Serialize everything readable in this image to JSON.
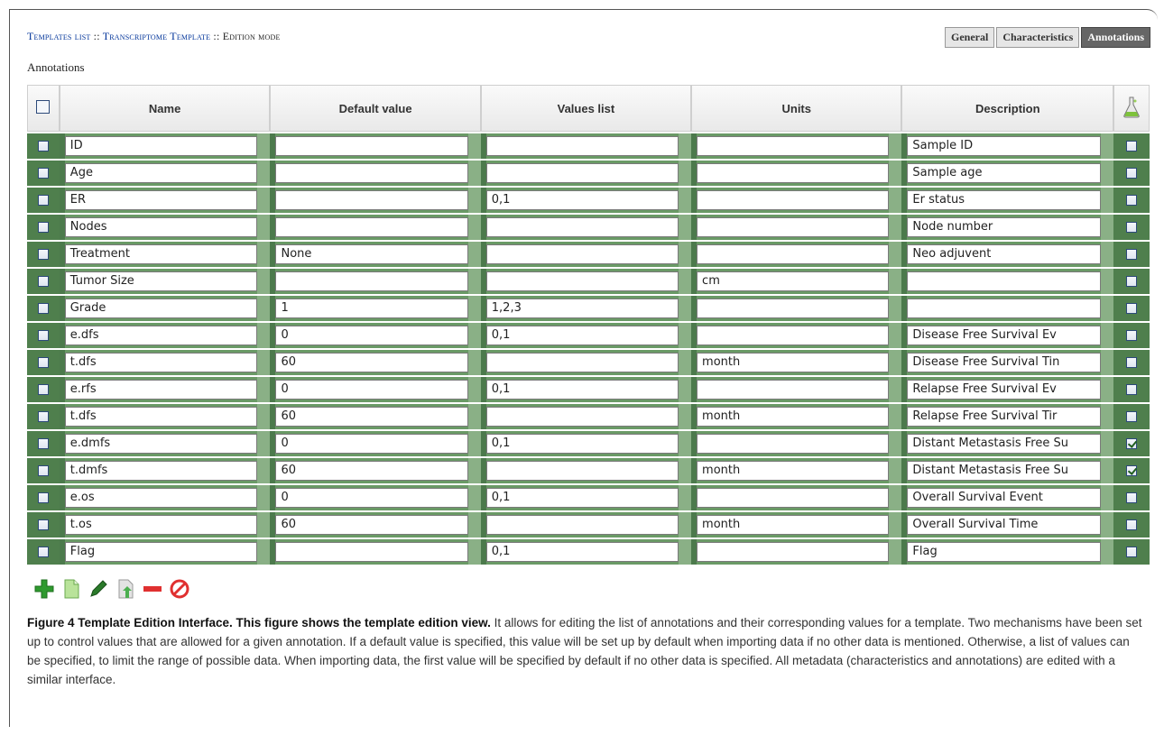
{
  "breadcrumb": {
    "templates_list": "Templates list",
    "sep1": " :: ",
    "template": "Transcriptome Template",
    "sep2": " :: ",
    "mode": "Edition mode"
  },
  "tabs": [
    {
      "label": "General",
      "active": false
    },
    {
      "label": "Characteristics",
      "active": false
    },
    {
      "label": "Annotations",
      "active": true
    }
  ],
  "section_title": "Annotations",
  "columns": {
    "name": "Name",
    "default_value": "Default value",
    "values_list": "Values list",
    "units": "Units",
    "description": "Description"
  },
  "header_icon": "flask-icon",
  "rows": [
    {
      "name": "ID",
      "default": "",
      "values": "",
      "units": "",
      "description": "Sample ID",
      "flag": false
    },
    {
      "name": "Age",
      "default": "",
      "values": "",
      "units": "",
      "description": "Sample age",
      "flag": false
    },
    {
      "name": "ER",
      "default": "",
      "values": "0,1",
      "units": "",
      "description": "Er status",
      "flag": false
    },
    {
      "name": "Nodes",
      "default": "",
      "values": "",
      "units": "",
      "description": "Node number",
      "flag": false
    },
    {
      "name": "Treatment",
      "default": "None",
      "values": "",
      "units": "",
      "description": "Neo adjuvent",
      "flag": false
    },
    {
      "name": "Tumor Size",
      "default": "",
      "values": "",
      "units": "cm",
      "description": "",
      "flag": false
    },
    {
      "name": "Grade",
      "default": "1",
      "values": "1,2,3",
      "units": "",
      "description": "",
      "flag": false
    },
    {
      "name": "e.dfs",
      "default": "0",
      "values": "0,1",
      "units": "",
      "description": "Disease Free Survival Ev",
      "flag": false
    },
    {
      "name": "t.dfs",
      "default": "60",
      "values": "",
      "units": "month",
      "description": "Disease Free Survival Tin",
      "flag": false
    },
    {
      "name": "e.rfs",
      "default": "0",
      "values": "0,1",
      "units": "",
      "description": "Relapse Free Survival Ev",
      "flag": false
    },
    {
      "name": "t.dfs",
      "default": "60",
      "values": "",
      "units": "month",
      "description": "Relapse Free Survival Tir",
      "flag": false
    },
    {
      "name": "e.dmfs",
      "default": "0",
      "values": "0,1",
      "units": "",
      "description": "Distant Metastasis Free Su",
      "flag": true
    },
    {
      "name": "t.dmfs",
      "default": "60",
      "values": "",
      "units": "month",
      "description": "Distant Metastasis Free Su",
      "flag": true
    },
    {
      "name": "e.os",
      "default": "0",
      "values": "0,1",
      "units": "",
      "description": "Overall Survival Event",
      "flag": false
    },
    {
      "name": "t.os",
      "default": "60",
      "values": "",
      "units": "month",
      "description": "Overall Survival Time",
      "flag": false
    },
    {
      "name": "Flag",
      "default": "",
      "values": "0,1",
      "units": "",
      "description": "Flag",
      "flag": false
    }
  ],
  "toolbar": [
    {
      "icon": "add-icon",
      "color": "#2e9a2e"
    },
    {
      "icon": "copy-document-icon",
      "color": "#8ccf6a"
    },
    {
      "icon": "edit-pencil-icon",
      "color": "#2a7a2a"
    },
    {
      "icon": "import-document-icon",
      "color": "#7cc25e"
    },
    {
      "icon": "remove-icon",
      "color": "#e03030"
    },
    {
      "icon": "cancel-icon",
      "color": "#e03030"
    }
  ],
  "caption": {
    "bold": "Figure 4 Template Edition Interface. This figure shows the template edition view.",
    "text": " It allows for editing the list of annotations and their corresponding values for a template. Two mechanisms have been set up to control values that are allowed for a given annotation. If a default value is specified, this value will be set up by default when importing data if no other data is mentioned. Otherwise, a list of values can be specified, to limit the range of possible data. When importing data, the first value will be specified by default if no other data is specified. All metadata (characteristics and annotations) are edited with a similar interface."
  },
  "colors": {
    "row_green": "#5d8a5a",
    "header_bg": "#f0f0f0",
    "active_tab": "#666666",
    "link": "#003399"
  }
}
